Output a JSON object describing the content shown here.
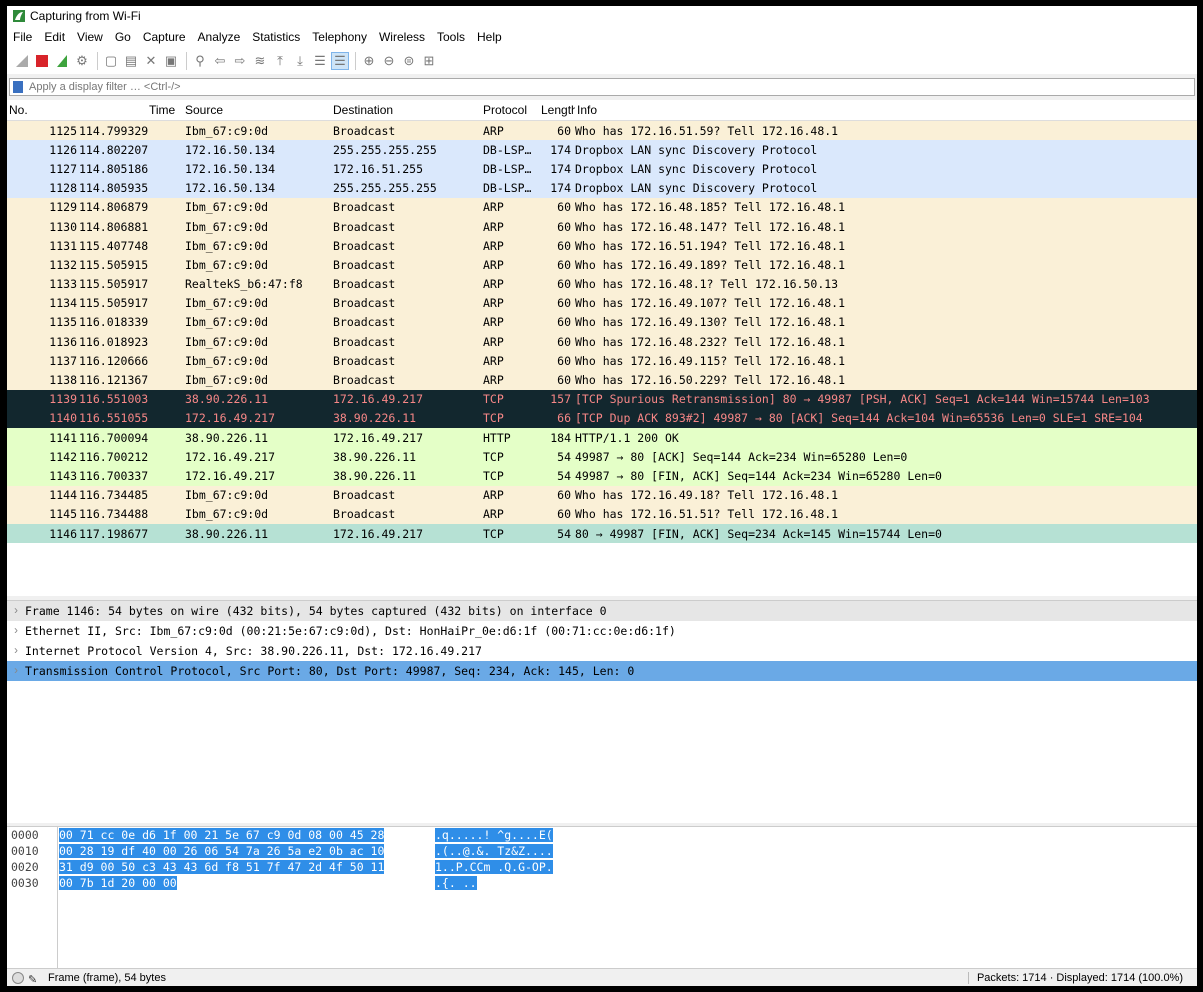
{
  "window": {
    "title": "Capturing from Wi-Fi"
  },
  "menu": [
    "File",
    "Edit",
    "View",
    "Go",
    "Capture",
    "Analyze",
    "Statistics",
    "Telephony",
    "Wireless",
    "Tools",
    "Help"
  ],
  "toolbar": {
    "icons": [
      "shark-fin-start-icon",
      "stop-icon",
      "restart-icon",
      "options-gear-icon",
      "open-file-icon",
      "save-file-icon",
      "close-file-icon",
      "reload-icon",
      "find-icon",
      "go-back-icon",
      "go-forward-icon",
      "go-to-packet-icon",
      "first-packet-icon",
      "last-packet-icon",
      "autoscroll-icon",
      "colorize-icon",
      "zoom-in-icon",
      "zoom-out-icon",
      "normal-size-icon",
      "resize-columns-icon"
    ]
  },
  "filter": {
    "placeholder": "Apply a display filter … <Ctrl-/>"
  },
  "columns": [
    "No.",
    "Time",
    "Source",
    "Destination",
    "Protocol",
    "Length",
    "Info"
  ],
  "colors": {
    "arp": "#faf0d7",
    "dropbox": "#dae8fc",
    "dark": "#12272e",
    "dark_text": "#f78787",
    "http": "#e4ffc7",
    "selected": "#b6e1d4"
  },
  "packets": [
    {
      "no": "1125",
      "time": "114.799329",
      "src": "Ibm_67:c9:0d",
      "dst": "Broadcast",
      "proto": "ARP",
      "len": "60",
      "info": "Who has 172.16.51.59? Tell 172.16.48.1",
      "kind": "arp"
    },
    {
      "no": "1126",
      "time": "114.802207",
      "src": "172.16.50.134",
      "dst": "255.255.255.255",
      "proto": "DB-LSP…",
      "len": "174",
      "info": "Dropbox LAN sync Discovery Protocol",
      "kind": "dropbox"
    },
    {
      "no": "1127",
      "time": "114.805186",
      "src": "172.16.50.134",
      "dst": "172.16.51.255",
      "proto": "DB-LSP…",
      "len": "174",
      "info": "Dropbox LAN sync Discovery Protocol",
      "kind": "dropbox"
    },
    {
      "no": "1128",
      "time": "114.805935",
      "src": "172.16.50.134",
      "dst": "255.255.255.255",
      "proto": "DB-LSP…",
      "len": "174",
      "info": "Dropbox LAN sync Discovery Protocol",
      "kind": "dropbox"
    },
    {
      "no": "1129",
      "time": "114.806879",
      "src": "Ibm_67:c9:0d",
      "dst": "Broadcast",
      "proto": "ARP",
      "len": "60",
      "info": "Who has 172.16.48.185? Tell 172.16.48.1",
      "kind": "arp"
    },
    {
      "no": "1130",
      "time": "114.806881",
      "src": "Ibm_67:c9:0d",
      "dst": "Broadcast",
      "proto": "ARP",
      "len": "60",
      "info": "Who has 172.16.48.147? Tell 172.16.48.1",
      "kind": "arp"
    },
    {
      "no": "1131",
      "time": "115.407748",
      "src": "Ibm_67:c9:0d",
      "dst": "Broadcast",
      "proto": "ARP",
      "len": "60",
      "info": "Who has 172.16.51.194? Tell 172.16.48.1",
      "kind": "arp"
    },
    {
      "no": "1132",
      "time": "115.505915",
      "src": "Ibm_67:c9:0d",
      "dst": "Broadcast",
      "proto": "ARP",
      "len": "60",
      "info": "Who has 172.16.49.189? Tell 172.16.48.1",
      "kind": "arp"
    },
    {
      "no": "1133",
      "time": "115.505917",
      "src": "RealtekS_b6:47:f8",
      "dst": "Broadcast",
      "proto": "ARP",
      "len": "60",
      "info": "Who has 172.16.48.1? Tell 172.16.50.13",
      "kind": "arp"
    },
    {
      "no": "1134",
      "time": "115.505917",
      "src": "Ibm_67:c9:0d",
      "dst": "Broadcast",
      "proto": "ARP",
      "len": "60",
      "info": "Who has 172.16.49.107? Tell 172.16.48.1",
      "kind": "arp"
    },
    {
      "no": "1135",
      "time": "116.018339",
      "src": "Ibm_67:c9:0d",
      "dst": "Broadcast",
      "proto": "ARP",
      "len": "60",
      "info": "Who has 172.16.49.130? Tell 172.16.48.1",
      "kind": "arp"
    },
    {
      "no": "1136",
      "time": "116.018923",
      "src": "Ibm_67:c9:0d",
      "dst": "Broadcast",
      "proto": "ARP",
      "len": "60",
      "info": "Who has 172.16.48.232? Tell 172.16.48.1",
      "kind": "arp"
    },
    {
      "no": "1137",
      "time": "116.120666",
      "src": "Ibm_67:c9:0d",
      "dst": "Broadcast",
      "proto": "ARP",
      "len": "60",
      "info": "Who has 172.16.49.115? Tell 172.16.48.1",
      "kind": "arp"
    },
    {
      "no": "1138",
      "time": "116.121367",
      "src": "Ibm_67:c9:0d",
      "dst": "Broadcast",
      "proto": "ARP",
      "len": "60",
      "info": "Who has 172.16.50.229? Tell 172.16.48.1",
      "kind": "arp"
    },
    {
      "no": "1139",
      "time": "116.551003",
      "src": "38.90.226.11",
      "dst": "172.16.49.217",
      "proto": "TCP",
      "len": "157",
      "info": "[TCP Spurious Retransmission] 80 → 49987 [PSH, ACK] Seq=1 Ack=144 Win=15744 Len=103",
      "kind": "dark"
    },
    {
      "no": "1140",
      "time": "116.551055",
      "src": "172.16.49.217",
      "dst": "38.90.226.11",
      "proto": "TCP",
      "len": "66",
      "info": "[TCP Dup ACK 893#2] 49987 → 80 [ACK] Seq=144 Ack=104 Win=65536 Len=0 SLE=1 SRE=104",
      "kind": "dark"
    },
    {
      "no": "1141",
      "time": "116.700094",
      "src": "38.90.226.11",
      "dst": "172.16.49.217",
      "proto": "HTTP",
      "len": "184",
      "info": "HTTP/1.1 200 OK",
      "kind": "http"
    },
    {
      "no": "1142",
      "time": "116.700212",
      "src": "172.16.49.217",
      "dst": "38.90.226.11",
      "proto": "TCP",
      "len": "54",
      "info": "49987 → 80 [ACK] Seq=144 Ack=234 Win=65280 Len=0",
      "kind": "http"
    },
    {
      "no": "1143",
      "time": "116.700337",
      "src": "172.16.49.217",
      "dst": "38.90.226.11",
      "proto": "TCP",
      "len": "54",
      "info": "49987 → 80 [FIN, ACK] Seq=144 Ack=234 Win=65280 Len=0",
      "kind": "http"
    },
    {
      "no": "1144",
      "time": "116.734485",
      "src": "Ibm_67:c9:0d",
      "dst": "Broadcast",
      "proto": "ARP",
      "len": "60",
      "info": "Who has 172.16.49.18? Tell 172.16.48.1",
      "kind": "arp"
    },
    {
      "no": "1145",
      "time": "116.734488",
      "src": "Ibm_67:c9:0d",
      "dst": "Broadcast",
      "proto": "ARP",
      "len": "60",
      "info": "Who has 172.16.51.51? Tell 172.16.48.1",
      "kind": "arp"
    },
    {
      "no": "1146",
      "time": "117.198677",
      "src": "38.90.226.11",
      "dst": "172.16.49.217",
      "proto": "TCP",
      "len": "54",
      "info": "80 → 49987 [FIN, ACK] Seq=234 Ack=145 Win=15744 Len=0",
      "kind": "selected"
    }
  ],
  "details": [
    "Frame 1146: 54 bytes on wire (432 bits), 54 bytes captured (432 bits) on interface 0",
    "Ethernet II, Src: Ibm_67:c9:0d (00:21:5e:67:c9:0d), Dst: HonHaiPr_0e:d6:1f (00:71:cc:0e:d6:1f)",
    "Internet Protocol Version 4, Src: 38.90.226.11, Dst: 172.16.49.217",
    "Transmission Control Protocol, Src Port: 80, Dst Port: 49987, Seq: 234, Ack: 145, Len: 0"
  ],
  "hex": [
    {
      "offset": "0000",
      "bytes": "00 71 cc 0e d6 1f 00 21  5e 67 c9 0d 08 00 45 28",
      "ascii": ".q.....! ^g....E("
    },
    {
      "offset": "0010",
      "bytes": "00 28 19 df 40 00 26 06  54 7a 26 5a e2 0b ac 10",
      "ascii": ".(..@.&. Tz&Z...."
    },
    {
      "offset": "0020",
      "bytes": "31 d9 00 50 c3 43 43 6d  f8 51 7f 47 2d 4f 50 11",
      "ascii": "1..P.CCm .Q.G-OP."
    },
    {
      "offset": "0030",
      "bytes": "00 7b 1d 20 00 00",
      "ascii": ".{. .."
    }
  ],
  "status": {
    "left": "Frame (frame), 54 bytes",
    "right": "Packets: 1714 · Displayed: 1714 (100.0%)"
  }
}
